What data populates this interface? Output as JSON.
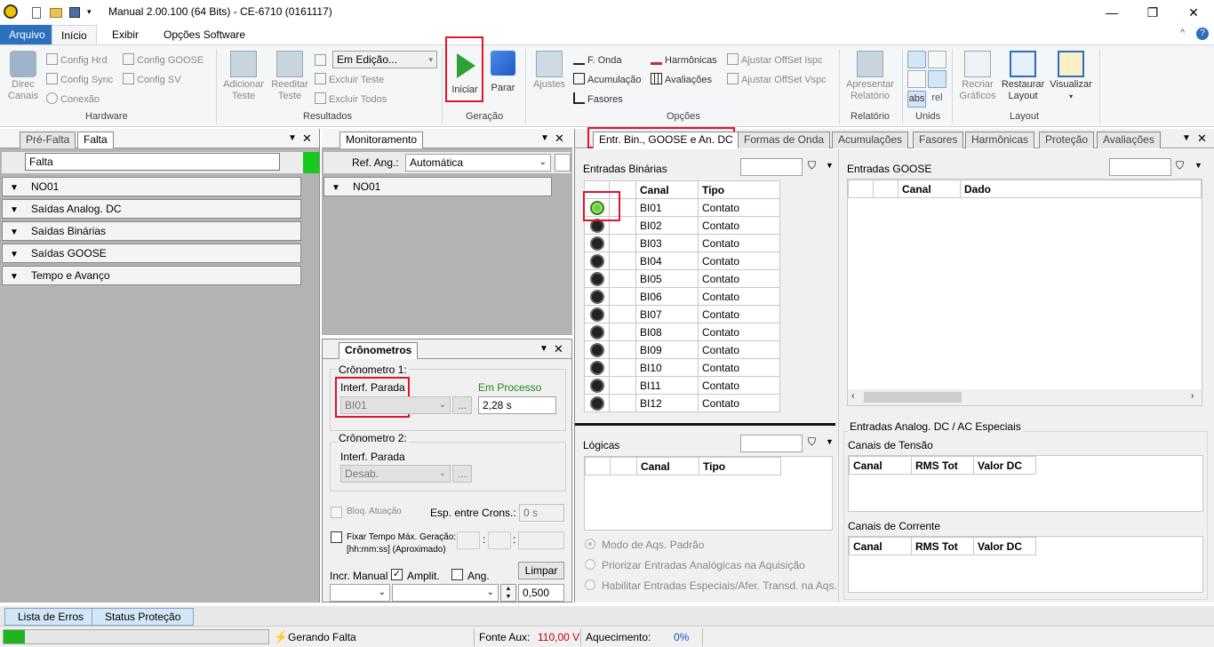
{
  "window": {
    "title": "Manual 2.00.100 (64 Bits) - CE-6710 (0161117)",
    "minimize": "—",
    "restore": "❐",
    "close": "✕"
  },
  "menu": {
    "tabs": [
      "Arquivo",
      "Início",
      "Exibir",
      "Opções Software"
    ],
    "help": "?",
    "collapse": "^"
  },
  "ribbon": {
    "hardware": {
      "label": "Hardware",
      "direc_canais": "Direc Canais",
      "config_hrd": "Config Hrd",
      "config_sync": "Config Sync",
      "conexao": "Conexão",
      "config_goose": "Config GOOSE",
      "config_sv": "Config SV"
    },
    "resultados": {
      "label": "Resultados",
      "adicionar_teste": "Adicionar Teste",
      "reeditar_teste": "Reeditar Teste",
      "status_value": "Em Edição...",
      "excluir_teste": "Excluir Teste",
      "excluir_todos": "Excluir Todos"
    },
    "geracao": {
      "label": "Geração",
      "iniciar": "Iniciar",
      "parar": "Parar"
    },
    "opcoes": {
      "label": "Opções",
      "ajustes": "Ajustes",
      "f_onda": "F. Onda",
      "acumulacao": "Acumulação",
      "fasores": "Fasores",
      "harmonicas": "Harmônicas",
      "avaliacoes": "Avaliações",
      "ajustar_ispc": "Ajustar OffSet Ispc",
      "ajustar_vspc": "Ajustar OffSet Vspc"
    },
    "relatorio": {
      "label": "Relatório",
      "apresentar": "Apresentar Relatório"
    },
    "unids": {
      "label": "Unids",
      "abs": "abs",
      "rel": "rel"
    },
    "layout": {
      "label": "Layout",
      "recriar": "Recriar Gráficos",
      "restaurar": "Restaurar Layout",
      "visualizar": "Visualizar"
    }
  },
  "left_pane": {
    "tabs": [
      "Pré-Falta",
      "Falta"
    ],
    "name_value": "Falta",
    "sections": [
      "NO01",
      "Saídas Analog. DC",
      "Saídas Binárias",
      "Saídas GOOSE",
      "Tempo e Avanço"
    ]
  },
  "monitor_pane": {
    "tab": "Monitoramento",
    "ref_ang_label": "Ref. Ang.:",
    "ref_ang_value": "Automática",
    "sections": [
      "NO01"
    ]
  },
  "crono_pane": {
    "tab": "Crônometros",
    "c1_label": "Crônometro 1:",
    "c1_interf": "Interf. Parada",
    "c1_em_processo": "Em Processo",
    "c1_channel": "BI01",
    "c1_time": "2,28 s",
    "c2_label": "Crônometro 2:",
    "c2_interf": "Interf. Parada",
    "c2_channel": "Desab.",
    "bloq": "Bloq. Atuação",
    "esp_label": "Esp. entre Crons.:",
    "esp_value": "0 s",
    "fixar": "Fixar Tempo Máx. Geração:",
    "fixar_hint": "[hh:mm:ss] (Aproximado)",
    "incr_manual": "Incr. Manual",
    "amplit": "Amplit.",
    "ang": "Ang.",
    "limpar": "Limpar",
    "step": "0,500",
    "ellipsis": "..."
  },
  "right_pane": {
    "tabs": [
      "Entr. Bin., GOOSE e An. DC",
      "Formas de Onda",
      "Acumulações",
      "Fasores",
      "Harmônicas",
      "Proteção",
      "Avaliações"
    ],
    "entradas_binarias": "Entradas Binárias",
    "bin_headers": [
      "Canal",
      "Tipo"
    ],
    "bin_rows": [
      {
        "canal": "BI01",
        "tipo": "Contato",
        "on": true
      },
      {
        "canal": "BI02",
        "tipo": "Contato",
        "on": false
      },
      {
        "canal": "BI03",
        "tipo": "Contato",
        "on": false
      },
      {
        "canal": "BI04",
        "tipo": "Contato",
        "on": false
      },
      {
        "canal": "BI05",
        "tipo": "Contato",
        "on": false
      },
      {
        "canal": "BI06",
        "tipo": "Contato",
        "on": false
      },
      {
        "canal": "BI07",
        "tipo": "Contato",
        "on": false
      },
      {
        "canal": "BI08",
        "tipo": "Contato",
        "on": false
      },
      {
        "canal": "BI09",
        "tipo": "Contato",
        "on": false
      },
      {
        "canal": "BI10",
        "tipo": "Contato",
        "on": false
      },
      {
        "canal": "BI11",
        "tipo": "Contato",
        "on": false
      },
      {
        "canal": "BI12",
        "tipo": "Contato",
        "on": false
      }
    ],
    "entradas_goose": "Entradas GOOSE",
    "goose_headers": [
      "Canal",
      "Dado"
    ],
    "logicas": "Lógicas",
    "logicas_headers": [
      "Canal",
      "Tipo"
    ],
    "analog_title": "Entradas Analog. DC / AC Especiais",
    "canais_tensao": "Canais de Tensão",
    "canais_corrente": "Canais de Corrente",
    "analog_headers": [
      "Canal",
      "RMS Tot",
      "Valor DC"
    ],
    "radios": [
      "Modo de Aqs. Padrão",
      "Priorizar Entradas Analógicas na Aquisição",
      "Habilitar Entradas Especiais/Afer. Transd. na Aqs."
    ]
  },
  "bottom_tabs": [
    "Lista de Erros",
    "Status Proteção"
  ],
  "status": {
    "progress": 0.08,
    "gerando": "Gerando Falta",
    "fonte_label": "Fonte Aux:",
    "fonte_value": "110,00 V",
    "aquec_label": "Aquecimento:",
    "aquec_value": "0%"
  },
  "colors": {
    "accent": "#2b6fbd",
    "led_on": "#6bd23d",
    "highlight": "#e0142a",
    "progress": "#1fb51f"
  }
}
